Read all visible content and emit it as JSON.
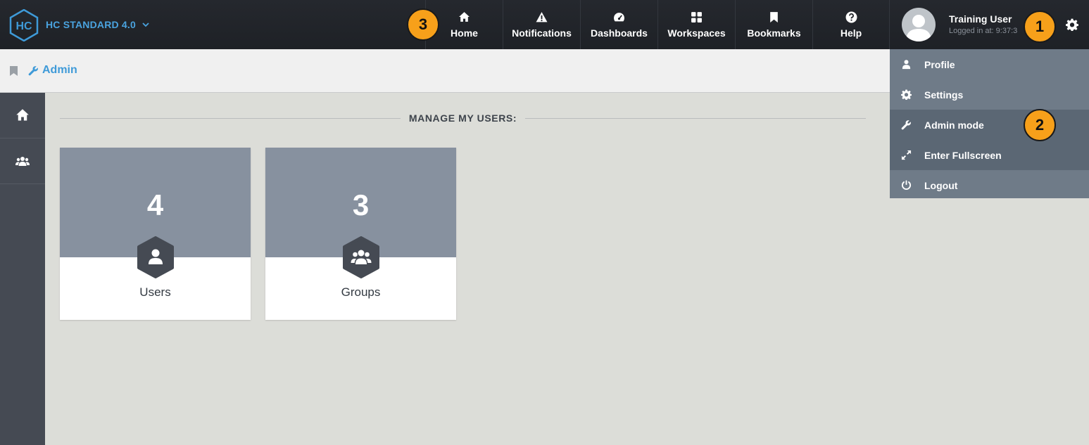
{
  "app": {
    "brand": "HC STANDARD 4.0",
    "logo_text": "HC"
  },
  "nav": [
    {
      "label": "Home",
      "icon": "home-icon"
    },
    {
      "label": "Notifications",
      "icon": "warning-icon"
    },
    {
      "label": "Dashboards",
      "icon": "dashboard-icon"
    },
    {
      "label": "Workspaces",
      "icon": "grid-icon"
    },
    {
      "label": "Bookmarks",
      "icon": "bookmark-icon"
    },
    {
      "label": "Help",
      "icon": "question-icon"
    }
  ],
  "user": {
    "name": "Training User",
    "logged_in": "Logged in at: 9:37:3"
  },
  "breadcrumb": {
    "label": "Admin"
  },
  "section": {
    "title": "MANAGE MY USERS:"
  },
  "cards": [
    {
      "count": "4",
      "label": "Users",
      "icon": "user-icon"
    },
    {
      "count": "3",
      "label": "Groups",
      "icon": "group-icon"
    }
  ],
  "user_menu": [
    {
      "label": "Profile",
      "icon": "user-icon"
    },
    {
      "label": "Settings",
      "icon": "gear-icon"
    },
    {
      "label": "Admin mode",
      "icon": "wrench-icon"
    },
    {
      "label": "Enter Fullscreen",
      "icon": "expand-icon"
    },
    {
      "label": "Logout",
      "icon": "power-icon"
    }
  ],
  "callouts": [
    "1",
    "2",
    "3"
  ],
  "colors": {
    "accent": "#4aa3df",
    "callout": "#f7a01a",
    "card_top": "#87919f",
    "menu_bg": "#6f7b88"
  }
}
